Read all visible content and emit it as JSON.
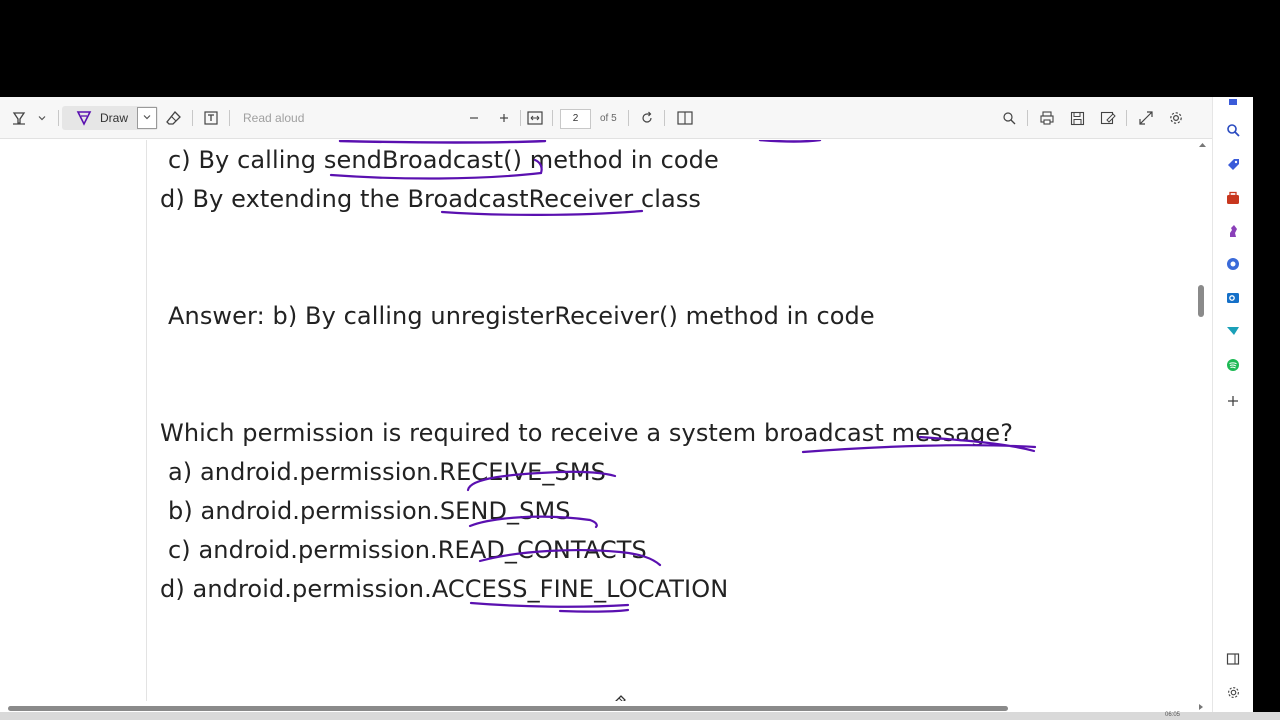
{
  "toolbar": {
    "draw_label": "Draw",
    "read_aloud_label": "Read aloud",
    "page_number": "2",
    "page_of": "of 5"
  },
  "document": {
    "lines": [
      "c) By calling sendBroadcast() method in code",
      "d) By extending the BroadcastReceiver class",
      "Answer: b) By calling unregisterReceiver() method in code",
      "Which permission is required to receive a system broadcast message?",
      "a) android.permission.RECEIVE_SMS",
      "b) android.permission.SEND_SMS",
      "c) android.permission.READ_CONTACTS",
      "d) android.permission.ACCESS_FINE_LOCATION"
    ]
  },
  "taskbar": {
    "clock": "06:05"
  },
  "colors": {
    "ink": "#5a10b0",
    "accent": "#3a5bd9",
    "app_background": "#000000"
  },
  "icons": {
    "toolbar": [
      "highlight-icon",
      "chevron-down-icon",
      "draw-pen-icon",
      "eraser-icon",
      "text-box-icon",
      "zoom-out-icon",
      "zoom-in-icon",
      "fit-width-icon",
      "rotate-icon",
      "page-view-icon",
      "search-icon",
      "print-icon",
      "save-icon",
      "save-as-icon",
      "fullscreen-icon",
      "settings-icon"
    ],
    "sidebar": [
      "bell-icon",
      "search-icon",
      "collections-icon",
      "toolbox-icon",
      "chess-icon",
      "copilot-icon",
      "outlook-icon",
      "feedback-icon",
      "spotify-icon",
      "add-icon",
      "panel-icon",
      "settings-icon"
    ]
  }
}
